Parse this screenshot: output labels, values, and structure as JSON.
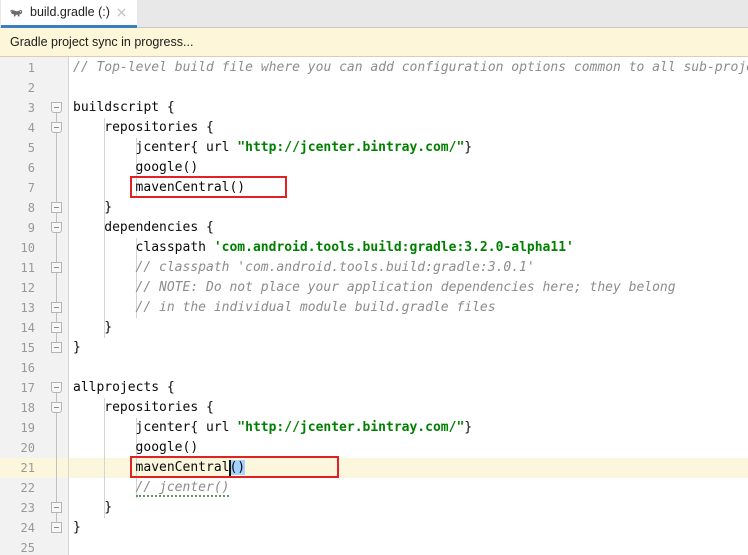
{
  "window": {
    "app": "Android Studio Editor",
    "filename": "build.gradle"
  },
  "tabbar": {
    "active_tab": {
      "label": "build.gradle (:)",
      "icon": "gradle-elephant-icon",
      "close_icon": "close-icon"
    }
  },
  "notification": {
    "message": "Gradle project sync in progress...",
    "background": "#fdf6d8"
  },
  "editor": {
    "language": "groovy",
    "current_line": 21,
    "colors": {
      "comment": "#8c8c8c",
      "string": "#008000",
      "code": "#0a0a0a",
      "line_number": "#999999",
      "current_line_bg": "#fcf6dd",
      "selection_bg": "#a6d2ff",
      "annotation_box": "#e02222"
    },
    "line_numbers": [
      1,
      2,
      3,
      4,
      5,
      6,
      7,
      8,
      9,
      10,
      11,
      12,
      13,
      14,
      15,
      16,
      17,
      18,
      19,
      20,
      21,
      22,
      23,
      24,
      25
    ],
    "lines": [
      {
        "n": 1,
        "indent": 0,
        "tokens": [
          {
            "t": "comment",
            "s": "// Top-level build file where you can add configuration options common to all sub-projects/modules"
          }
        ]
      },
      {
        "n": 2,
        "indent": 0,
        "tokens": []
      },
      {
        "n": 3,
        "indent": 0,
        "tokens": [
          {
            "t": "plain",
            "s": "buildscript {"
          }
        ]
      },
      {
        "n": 4,
        "indent": 1,
        "tokens": [
          {
            "t": "plain",
            "s": "repositories {"
          }
        ]
      },
      {
        "n": 5,
        "indent": 2,
        "tokens": [
          {
            "t": "plain",
            "s": "jcenter{ url "
          },
          {
            "t": "string",
            "s": "\"http://jcenter.bintray.com/\""
          },
          {
            "t": "plain",
            "s": "}"
          }
        ]
      },
      {
        "n": 6,
        "indent": 2,
        "tokens": [
          {
            "t": "plain",
            "s": "google()"
          }
        ]
      },
      {
        "n": 7,
        "indent": 2,
        "tokens": [
          {
            "t": "plain",
            "s": "mavenCentral()"
          }
        ]
      },
      {
        "n": 8,
        "indent": 1,
        "tokens": [
          {
            "t": "plain",
            "s": "}"
          }
        ]
      },
      {
        "n": 9,
        "indent": 1,
        "tokens": [
          {
            "t": "plain",
            "s": "dependencies {"
          }
        ]
      },
      {
        "n": 10,
        "indent": 2,
        "tokens": [
          {
            "t": "plain",
            "s": "classpath "
          },
          {
            "t": "string",
            "s": "'com.android.tools.build:gradle:3.2.0-alpha11'"
          }
        ]
      },
      {
        "n": 11,
        "indent": 2,
        "tokens": [
          {
            "t": "comment",
            "s": "// classpath 'com.android.tools.build:gradle:3.0.1'"
          }
        ]
      },
      {
        "n": 12,
        "indent": 2,
        "tokens": [
          {
            "t": "comment",
            "s": "// NOTE: Do not place your application dependencies here; they belong"
          }
        ]
      },
      {
        "n": 13,
        "indent": 2,
        "tokens": [
          {
            "t": "comment",
            "s": "// in the individual module build.gradle files"
          }
        ]
      },
      {
        "n": 14,
        "indent": 1,
        "tokens": [
          {
            "t": "plain",
            "s": "}"
          }
        ]
      },
      {
        "n": 15,
        "indent": 0,
        "tokens": [
          {
            "t": "plain",
            "s": "}"
          }
        ]
      },
      {
        "n": 16,
        "indent": 0,
        "tokens": []
      },
      {
        "n": 17,
        "indent": 0,
        "tokens": [
          {
            "t": "plain",
            "s": "allprojects {"
          }
        ]
      },
      {
        "n": 18,
        "indent": 1,
        "tokens": [
          {
            "t": "plain",
            "s": "repositories {"
          }
        ]
      },
      {
        "n": 19,
        "indent": 2,
        "tokens": [
          {
            "t": "plain",
            "s": "jcenter{ url "
          },
          {
            "t": "string",
            "s": "\"http://jcenter.bintray.com/\""
          },
          {
            "t": "plain",
            "s": "}"
          }
        ]
      },
      {
        "n": 20,
        "indent": 2,
        "tokens": [
          {
            "t": "plain",
            "s": "google()"
          }
        ]
      },
      {
        "n": 21,
        "indent": 2,
        "tokens": [
          {
            "t": "plain",
            "s": "mavenCentral"
          },
          {
            "t": "selection",
            "s": "()"
          }
        ]
      },
      {
        "n": 22,
        "indent": 2,
        "tokens": [
          {
            "t": "comment-squiggle",
            "s": "// jcenter()"
          }
        ]
      },
      {
        "n": 23,
        "indent": 1,
        "tokens": [
          {
            "t": "plain",
            "s": "}"
          }
        ]
      },
      {
        "n": 24,
        "indent": 0,
        "tokens": [
          {
            "t": "plain",
            "s": "}"
          }
        ]
      },
      {
        "n": 25,
        "indent": 0,
        "tokens": []
      }
    ],
    "fold_markers": [
      3,
      4,
      8,
      9,
      11,
      13,
      14,
      15,
      17,
      18,
      23,
      24
    ],
    "annotations": [
      {
        "name": "redbox-mavencentral-buildscript",
        "line": 7,
        "label": "mavenCentral()"
      },
      {
        "name": "redbox-mavencentral-allprojects",
        "line": 21,
        "label": "mavenCentral()"
      }
    ],
    "caret": {
      "line": 21,
      "column": 20
    }
  }
}
